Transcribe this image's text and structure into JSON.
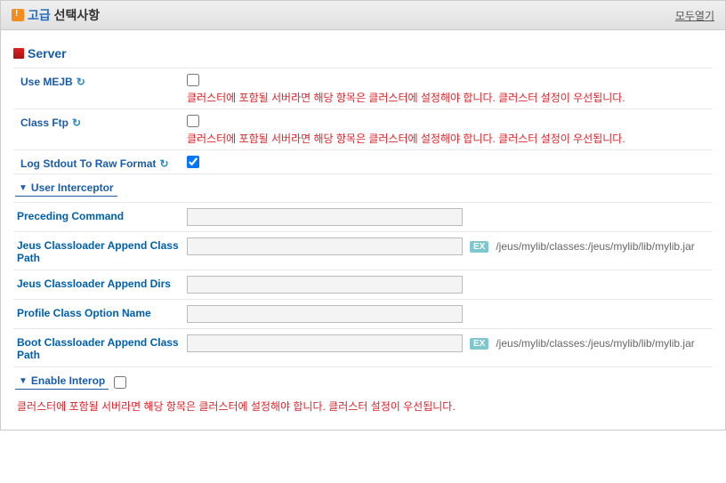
{
  "header": {
    "advanced": "고급",
    "selection": "선택사항",
    "openAll": "모두열기"
  },
  "section": {
    "server": "Server"
  },
  "rows": {
    "useMejb": {
      "label": "Use MEJB",
      "warn": "클러스터에 포함될 서버라면 해당 항목은 클러스터에 설정해야 합니다. 클러스터 설정이 우선됩니다."
    },
    "classFtp": {
      "label": "Class Ftp",
      "warn": "클러스터에 포함될 서버라면 해당 항목은 클러스터에 설정해야 합니다. 클러스터 설정이 우선됩니다."
    },
    "logStdout": {
      "label": "Log Stdout To Raw Format"
    }
  },
  "userInterceptor": {
    "title": "User Interceptor",
    "precedingCommand": {
      "label": "Preceding Command",
      "value": ""
    },
    "jeusAppendClassPath": {
      "label": "Jeus Classloader Append Class Path",
      "value": "",
      "ex": "/jeus/mylib/classes:/jeus/mylib/lib/mylib.jar"
    },
    "jeusAppendDirs": {
      "label": "Jeus Classloader Append Dirs",
      "value": ""
    },
    "profileClassOption": {
      "label": "Profile Class Option Name",
      "value": ""
    },
    "bootAppendClassPath": {
      "label": "Boot Classloader Append Class Path",
      "value": "",
      "ex": "/jeus/mylib/classes:/jeus/mylib/lib/mylib.jar"
    }
  },
  "enableInterop": {
    "title": "Enable Interop",
    "warn": "클러스터에 포함될 서버라면 해당 항목은 클러스터에 설정해야 합니다. 클러스터 설정이 우선됩니다."
  },
  "exBadge": "EX"
}
